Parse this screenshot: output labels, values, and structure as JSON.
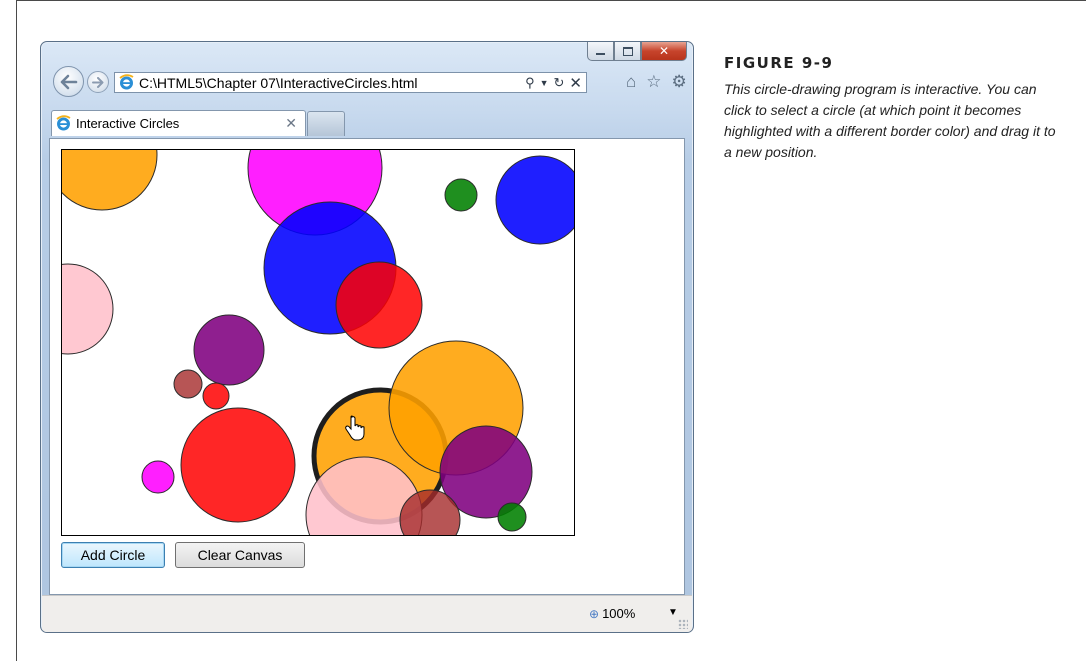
{
  "browser": {
    "address_url": "C:\\HTML5\\Chapter 07\\InteractiveCircles.html",
    "tab_title": "Interactive Circles",
    "zoom_level": "100%",
    "icons": [
      "back-icon",
      "forward-icon",
      "ie-logo-icon",
      "search-icon",
      "dropdown-icon",
      "refresh-icon",
      "stop-icon",
      "home-icon",
      "favorites-star-icon",
      "settings-gear-icon",
      "tab-close-icon",
      "zoom-icon"
    ]
  },
  "page": {
    "buttons": {
      "add_circle": "Add Circle",
      "clear_canvas": "Clear Canvas"
    },
    "circles": [
      {
        "color": "orange",
        "selected": false
      },
      {
        "color": "magenta",
        "selected": false
      },
      {
        "color": "green",
        "selected": false
      },
      {
        "color": "blue",
        "selected": false
      },
      {
        "color": "pink",
        "selected": false
      },
      {
        "color": "blue",
        "selected": false
      },
      {
        "color": "red",
        "selected": false
      },
      {
        "color": "purple",
        "selected": false
      },
      {
        "color": "brown",
        "selected": false
      },
      {
        "color": "red",
        "selected": false
      },
      {
        "color": "orange",
        "selected": true
      },
      {
        "color": "orange",
        "selected": false
      },
      {
        "color": "purple",
        "selected": false
      },
      {
        "color": "red",
        "selected": false
      },
      {
        "color": "magenta",
        "selected": false
      },
      {
        "color": "pink",
        "selected": false
      },
      {
        "color": "brown",
        "selected": false
      },
      {
        "color": "green",
        "selected": false
      }
    ]
  },
  "figure": {
    "title": "FIGURE 9-9",
    "caption": "This circle-drawing program is interactive. You can click to select a circle (at which point it becomes highlighted with a different border color) and drag it to a new position."
  }
}
